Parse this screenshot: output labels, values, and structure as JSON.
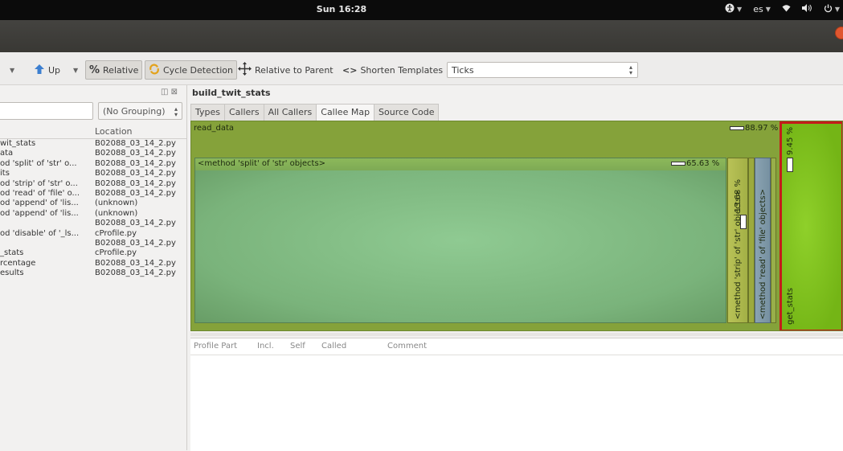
{
  "system": {
    "clock": "Sun 16:28",
    "keyboard": "es"
  },
  "toolbar": {
    "up": "Up",
    "relative": "Relative",
    "cycle_detection": "Cycle Detection",
    "relative_to_parent": "Relative to Parent",
    "shorten_templates": "Shorten Templates",
    "event_type": "Ticks"
  },
  "left_panel": {
    "search_value": "",
    "grouping": "(No Grouping)",
    "column_location": "Location",
    "rows": [
      {
        "function": "wit_stats",
        "location": "B02088_03_14_2.py"
      },
      {
        "function": "ata",
        "location": "B02088_03_14_2.py"
      },
      {
        "function": "od 'split' of 'str' o...",
        "location": "B02088_03_14_2.py"
      },
      {
        "function": "its",
        "location": "B02088_03_14_2.py"
      },
      {
        "function": "od 'strip' of 'str' o...",
        "location": "B02088_03_14_2.py"
      },
      {
        "function": "od 'read' of 'file' o...",
        "location": "B02088_03_14_2.py"
      },
      {
        "function": "od 'append' of 'lis...",
        "location": "(unknown)"
      },
      {
        "function": "od 'append' of 'lis...",
        "location": "(unknown)"
      },
      {
        "function": "",
        "location": "B02088_03_14_2.py"
      },
      {
        "function": "od 'disable' of '_ls...",
        "location": "cProfile.py"
      },
      {
        "function": "",
        "location": "B02088_03_14_2.py"
      },
      {
        "function": "_stats",
        "location": "cProfile.py"
      },
      {
        "function": "rcentage",
        "location": "B02088_03_14_2.py"
      },
      {
        "function": "esults",
        "location": "B02088_03_14_2.py"
      }
    ]
  },
  "right_panel": {
    "function_title": "build_twit_stats",
    "tabs": [
      "Types",
      "Callers",
      "All Callers",
      "Callee Map",
      "Source Code"
    ],
    "active_tab": "Callee Map",
    "callee_map": {
      "read_data": {
        "label": "read_data",
        "percent": "88.97 %"
      },
      "split": {
        "label": "<method 'split' of 'str' objects>",
        "percent": "65.63 %"
      },
      "strip": {
        "label": "<method 'strip' of 'str' objects>",
        "percent": "13.68 %"
      },
      "read": {
        "label": "<method 'read' of 'file' objects>"
      },
      "get_stats": {
        "label": "get_stats",
        "percent": "9.45 %"
      }
    },
    "profile_parts_columns": [
      "Profile Part",
      "Incl.",
      "Self",
      "Called",
      "Comment"
    ]
  },
  "colors": {
    "read_data": "#85a23a",
    "split": "#7fb87a",
    "strip": "#a9b64a",
    "read": "#7f97a6",
    "get_stats": "#7eb81a",
    "highlight": "#c41b1b"
  }
}
